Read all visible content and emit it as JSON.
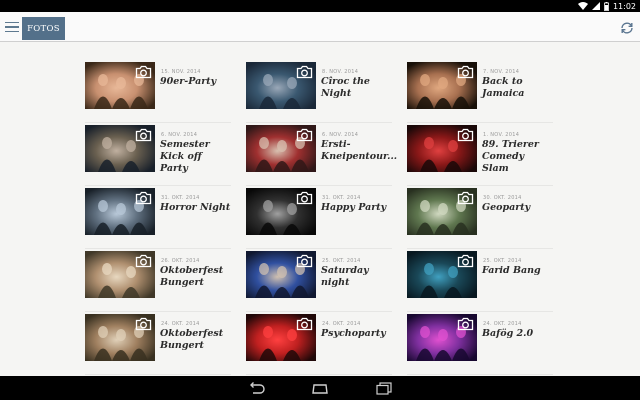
{
  "status_bar": {
    "time": "11:02"
  },
  "header": {
    "tab_label": "FOTOS"
  },
  "albums": [
    {
      "date": "15. NOV. 2014",
      "title": "90er-Party",
      "bg": [
        "#3a2818",
        "#c89070",
        "#e8b898"
      ]
    },
    {
      "date": "8. NOV. 2014",
      "title": "Cîroc the Night",
      "bg": [
        "#1a2838",
        "#3a5870",
        "#9aa8b8"
      ]
    },
    {
      "date": "7. NOV. 2014",
      "title": "Back to Jamaica",
      "bg": [
        "#181008",
        "#a87050",
        "#e0a880"
      ]
    },
    {
      "date": "6. NOV. 2014",
      "title": "Semester Kick off Party",
      "bg": [
        "#18202a",
        "#6a6050",
        "#c0b0a0"
      ]
    },
    {
      "date": "6. NOV. 2014",
      "title": "Ersti-Kneipentour...",
      "bg": [
        "#301818",
        "#a03030",
        "#d8c0b0"
      ]
    },
    {
      "date": "1. NOV. 2014",
      "title": "89. Trierer Comedy Slam",
      "bg": [
        "#1a0808",
        "#8a1818",
        "#e04040"
      ]
    },
    {
      "date": "31. OKT. 2014",
      "title": "Horror Night",
      "bg": [
        "#182028",
        "#607080",
        "#b8c8d8"
      ]
    },
    {
      "date": "31. OKT. 2014",
      "title": "Happy Party",
      "bg": [
        "#080808",
        "#303030",
        "#a0a0a0"
      ]
    },
    {
      "date": "30. OKT. 2014",
      "title": "Geoparty",
      "bg": [
        "#283020",
        "#607850",
        "#d0d8c0"
      ]
    },
    {
      "date": "26. OKT. 2014",
      "title": "Oktoberfest Bungert",
      "bg": [
        "#403828",
        "#b09070",
        "#e8d8c0"
      ]
    },
    {
      "date": "25. OKT. 2014",
      "title": "Saturday night",
      "bg": [
        "#101830",
        "#3050a0",
        "#d0c0b0"
      ]
    },
    {
      "date": "25. OKT. 2014",
      "title": "Farid Bang",
      "bg": [
        "#081820",
        "#1a4858",
        "#40a0c0"
      ]
    },
    {
      "date": "24. OKT. 2014",
      "title": "Oktoberfest Bungert",
      "bg": [
        "#383020",
        "#a08060",
        "#e0d0b8"
      ]
    },
    {
      "date": "24. OKT. 2014",
      "title": "Psychoparty",
      "bg": [
        "#200808",
        "#c02020",
        "#ff4040"
      ]
    },
    {
      "date": "24. OKT. 2014",
      "title": "Bafög 2.0",
      "bg": [
        "#180830",
        "#8030a0",
        "#e050d0"
      ]
    }
  ],
  "colors": {
    "accent": "#53708a",
    "background": "#f5f5f3"
  },
  "icons": {
    "menu": "hamburger-icon",
    "refresh": "refresh-icon",
    "album": "camera-icon",
    "back": "back-icon",
    "home": "home-icon",
    "recents": "recents-icon"
  }
}
